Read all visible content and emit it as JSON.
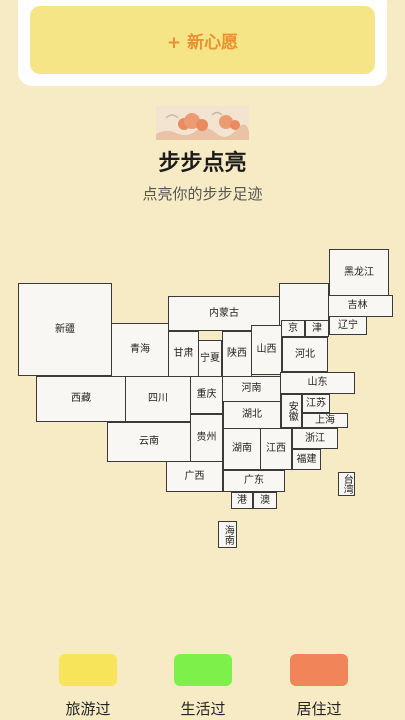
{
  "wish_button": {
    "label": "+ 新心愿"
  },
  "header": {
    "title": "步步点亮",
    "subtitle": "点亮你的步步足迹"
  },
  "map": {
    "provinces": [
      {
        "id": "heilongjiang",
        "label": "黑龙江"
      },
      {
        "id": "jilin",
        "label": "吉林"
      },
      {
        "id": "liaoning",
        "label": "辽宁"
      },
      {
        "id": "neimenggu",
        "label": "内蒙古"
      },
      {
        "id": "beijing",
        "label": "京"
      },
      {
        "id": "tianjin",
        "label": "津"
      },
      {
        "id": "hebei",
        "label": "河北"
      },
      {
        "id": "shanxi",
        "label": "山西"
      },
      {
        "id": "xinjiang",
        "label": "新疆"
      },
      {
        "id": "qinghai",
        "label": "青海"
      },
      {
        "id": "gansu",
        "label": "甘肃"
      },
      {
        "id": "ningxia",
        "label": "宁夏"
      },
      {
        "id": "shaanxi",
        "label": "陕西"
      },
      {
        "id": "shandong",
        "label": "山东"
      },
      {
        "id": "henan",
        "label": "河南"
      },
      {
        "id": "xizang",
        "label": "西藏"
      },
      {
        "id": "sichuan",
        "label": "四川"
      },
      {
        "id": "chongqing",
        "label": "重庆"
      },
      {
        "id": "hubei",
        "label": "湖北"
      },
      {
        "id": "anhui",
        "label": "安徽"
      },
      {
        "id": "jiangsu",
        "label": "江苏"
      },
      {
        "id": "shanghai",
        "label": "上海"
      },
      {
        "id": "yunnan",
        "label": "云南"
      },
      {
        "id": "guizhou",
        "label": "贵州"
      },
      {
        "id": "hunan",
        "label": "湖南"
      },
      {
        "id": "jiangxi",
        "label": "江西"
      },
      {
        "id": "zhejiang",
        "label": "浙江"
      },
      {
        "id": "fujian",
        "label": "福建"
      },
      {
        "id": "taiwan",
        "label": "台湾"
      },
      {
        "id": "guangxi",
        "label": "广西"
      },
      {
        "id": "guangdong",
        "label": "广东"
      },
      {
        "id": "hongkong",
        "label": "港"
      },
      {
        "id": "macau",
        "label": "澳"
      },
      {
        "id": "hainan",
        "label": "海南"
      }
    ]
  },
  "legend": [
    {
      "label": "旅游过",
      "color": "#f7e45a"
    },
    {
      "label": "生活过",
      "color": "#7ef04a"
    },
    {
      "label": "居住过",
      "color": "#f2845a"
    }
  ],
  "colors": {
    "background": "#f6ebc5",
    "wish_button_bg": "#f5e587",
    "wish_button_text": "#e9922f"
  }
}
